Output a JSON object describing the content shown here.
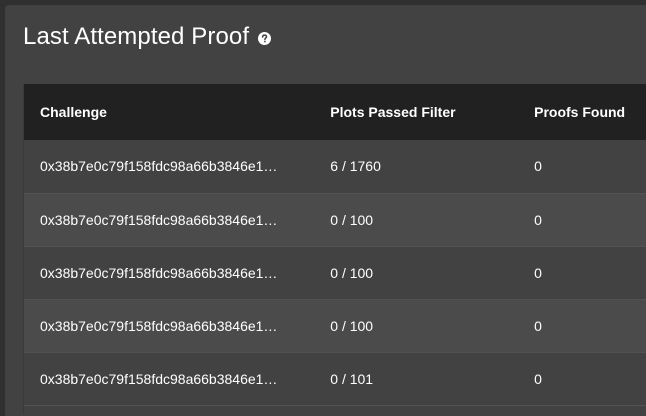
{
  "card": {
    "title": "Last Attempted Proof",
    "help_icon": "question-circle-icon"
  },
  "table": {
    "headers": [
      "Challenge",
      "Plots Passed Filter",
      "Proofs Found"
    ],
    "rows": [
      {
        "challenge": "0x38b7e0c79f158fdc98a66b3846e1…",
        "plots_passed": "6 / 1760",
        "proofs_found": "0"
      },
      {
        "challenge": "0x38b7e0c79f158fdc98a66b3846e1…",
        "plots_passed": "0 / 100",
        "proofs_found": "0"
      },
      {
        "challenge": "0x38b7e0c79f158fdc98a66b3846e1…",
        "plots_passed": "0 / 100",
        "proofs_found": "0"
      },
      {
        "challenge": "0x38b7e0c79f158fdc98a66b3846e1…",
        "plots_passed": "0 / 100",
        "proofs_found": "0"
      },
      {
        "challenge": "0x38b7e0c79f158fdc98a66b3846e1…",
        "plots_passed": "0 / 101",
        "proofs_found": "0"
      }
    ]
  },
  "colors": {
    "background": "#303030",
    "card": "#424242",
    "header_row": "#212121",
    "alt_row": "#4b4b4b",
    "text": "#ffffff"
  }
}
